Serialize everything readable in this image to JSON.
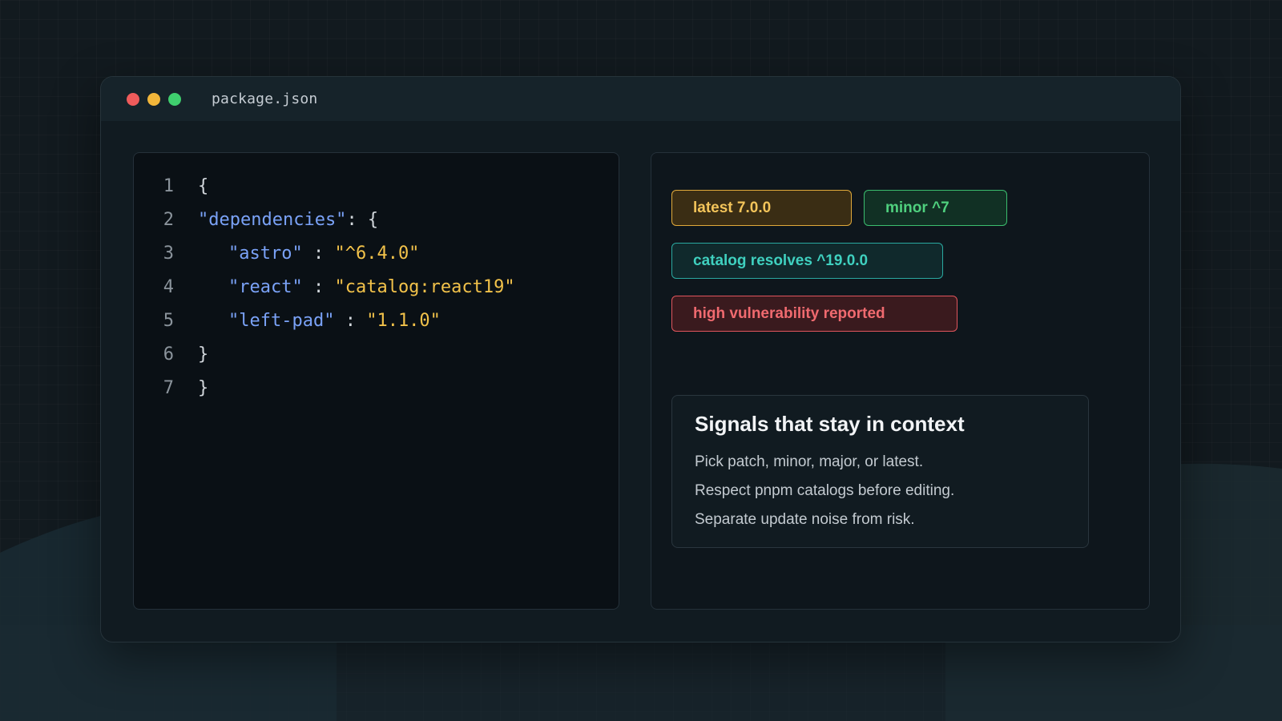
{
  "window": {
    "title": "package.json"
  },
  "code": {
    "lines": [
      {
        "n": "1",
        "text": "{"
      },
      {
        "n": "2",
        "key": "\"dependencies\"",
        "sep": ": {"
      },
      {
        "n": "3",
        "key": "\"astro\"",
        "sep": " : ",
        "value": "\"^6.4.0\""
      },
      {
        "n": "4",
        "key": "\"react\"",
        "sep": " : ",
        "value": "\"catalog:react19\""
      },
      {
        "n": "5",
        "key": "\"left-pad\"",
        "sep": " : ",
        "value": "\"1.1.0\""
      },
      {
        "n": "6",
        "text": "}"
      },
      {
        "n": "7",
        "text": "}"
      }
    ]
  },
  "badges": {
    "latest": "latest 7.0.0",
    "minor": "minor ^7",
    "catalog": "catalog resolves ^19.0.0",
    "vulnerability": "high vulnerability reported"
  },
  "info": {
    "title": "Signals that stay in context",
    "lines": [
      "Pick patch, minor, major, or latest.",
      "Respect pnpm catalogs before editing.",
      "Separate update noise from risk."
    ]
  },
  "colors": {
    "latest": "#f3c45a",
    "minor": "#4fd07e",
    "catalog": "#3fd0bf",
    "vulnerability": "#f06a6f",
    "code_key": "#7aa2f7",
    "code_string": "#f2c24a"
  }
}
